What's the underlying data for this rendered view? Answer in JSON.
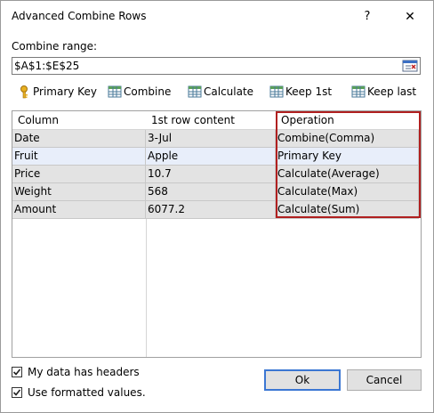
{
  "window": {
    "title": "Advanced Combine Rows",
    "help_glyph": "?",
    "close_glyph": "✕"
  },
  "range": {
    "label": "Combine range:",
    "value": "$A$1:$E$25",
    "picker_icon": "range-picker-icon"
  },
  "toolbar": {
    "primary_key": "Primary Key",
    "combine": "Combine",
    "calculate": "Calculate",
    "keep_first": "Keep 1st",
    "keep_last": "Keep last"
  },
  "grid": {
    "headers": [
      "Column",
      "1st row content",
      "Operation"
    ],
    "rows": [
      {
        "column": "Date",
        "content": "3-Jul",
        "operation": "Combine(Comma)"
      },
      {
        "column": "Fruit",
        "content": "Apple",
        "operation": "Primary Key"
      },
      {
        "column": "Price",
        "content": "10.7",
        "operation": "Calculate(Average)"
      },
      {
        "column": "Weight",
        "content": "568",
        "operation": "Calculate(Max)"
      },
      {
        "column": "Amount",
        "content": "6077.2",
        "operation": "Calculate(Sum)"
      }
    ],
    "highlight_color": "#b02020",
    "selected_row_color": "#e8eefa",
    "row_color": "#e3e3e3"
  },
  "options": {
    "headers_label": "My data has headers",
    "headers_checked": true,
    "formatted_label": "Use formatted values.",
    "formatted_checked": true
  },
  "buttons": {
    "ok": "Ok",
    "cancel": "Cancel"
  }
}
